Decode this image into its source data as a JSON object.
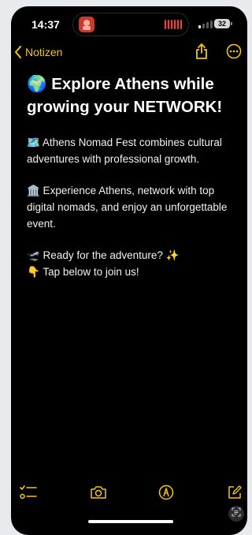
{
  "status_bar": {
    "time": "14:37",
    "battery": "32"
  },
  "nav": {
    "back_label": "Notizen",
    "share_icon": "share-icon",
    "more_icon": "ellipsis-circle-icon"
  },
  "note": {
    "title": "🌍 Explore Athens while growing your NETWORK!",
    "paragraphs": [
      {
        "lines": [
          "🗺️ Athens Nomad Fest combines cultural adventures with professional growth."
        ]
      },
      {
        "lines": [
          "🏛️ Experience Athens, network with top digital nomads, and enjoy an unforgettable event."
        ]
      },
      {
        "lines": [
          "🛫 Ready for the adventure? ✨",
          "👇 Tap below to join us!"
        ]
      }
    ]
  },
  "toolbar": {
    "checklist_icon": "checklist-icon",
    "camera_icon": "camera-icon",
    "markup_icon": "markup-pen-icon",
    "compose_icon": "compose-icon"
  },
  "colors": {
    "accent": "#f5c518",
    "background": "#000000",
    "text": "#ffffff"
  }
}
